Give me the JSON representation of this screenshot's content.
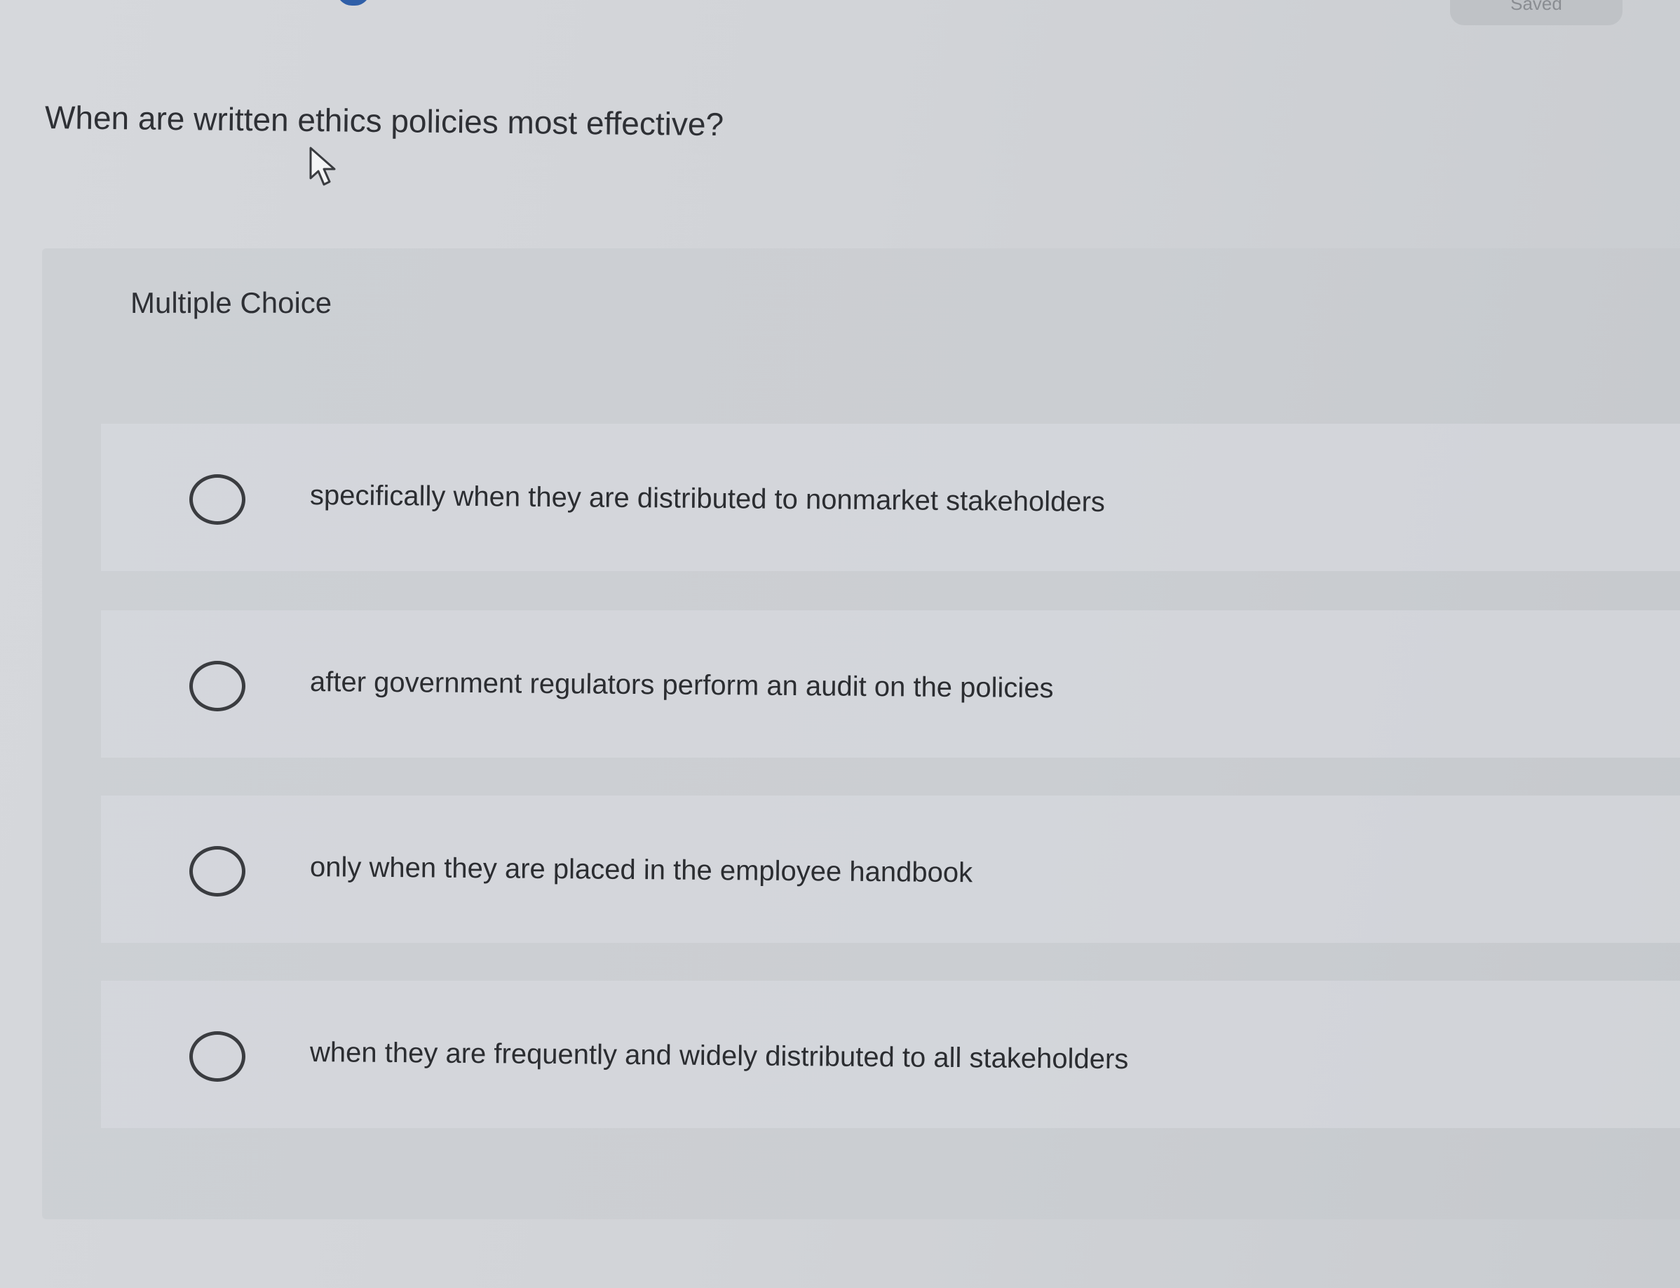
{
  "status": {
    "saved_label": "Saved"
  },
  "question": {
    "text": "When are written ethics policies most effective?"
  },
  "quiz": {
    "type_label": "Multiple Choice",
    "choices": [
      {
        "label": "specifically when they are distributed to nonmarket stakeholders",
        "selected": false
      },
      {
        "label": "after government regulators perform an audit on the policies",
        "selected": false
      },
      {
        "label": "only when they are placed in the employee handbook",
        "selected": false
      },
      {
        "label": "when they are frequently and widely distributed to all stakeholders",
        "selected": false
      }
    ]
  },
  "icons": {
    "cursor": "mouse-pointer-icon",
    "radio": "radio-button-unselected"
  },
  "colors": {
    "background": "#d3d5d9",
    "card": "#cbced2",
    "text": "#2b2d31",
    "accent": "#2f5fa8"
  }
}
